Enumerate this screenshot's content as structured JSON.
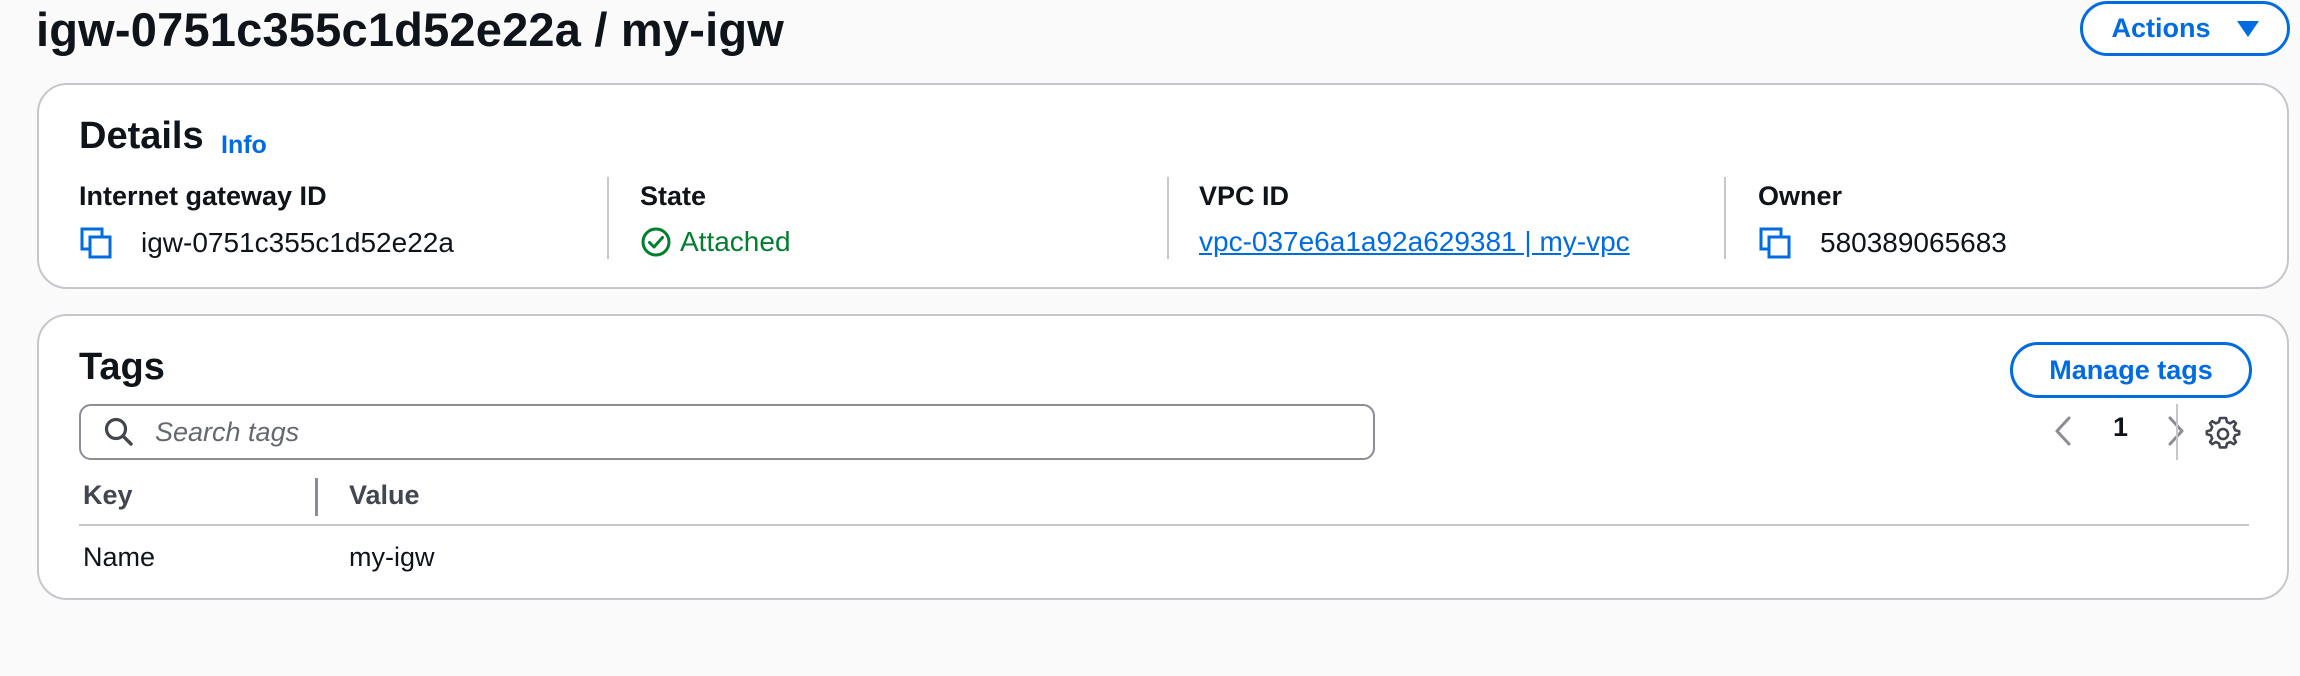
{
  "header": {
    "title": "igw-0751c355c1d52e22a / my-igw",
    "actions_label": "Actions"
  },
  "details": {
    "heading": "Details",
    "info_label": "Info",
    "fields": [
      {
        "label": "Internet gateway ID",
        "value": "igw-0751c355c1d52e22a"
      },
      {
        "label": "State",
        "value": "Attached"
      },
      {
        "label": "VPC ID",
        "value": "vpc-037e6a1a92a629381 | my-vpc"
      },
      {
        "label": "Owner",
        "value": "580389065683"
      }
    ]
  },
  "tags": {
    "heading": "Tags",
    "manage_label": "Manage tags",
    "search_placeholder": "Search tags",
    "page_number": "1",
    "columns": [
      "Key",
      "Value"
    ],
    "rows": [
      {
        "key": "Name",
        "value": "my-igw"
      }
    ]
  },
  "colors": {
    "accent": "#006ce0",
    "success": "#00802f",
    "border": "#c6c6cd"
  },
  "icons": [
    "copy-icon",
    "check-circle-icon",
    "search-icon",
    "chevron-left-icon",
    "chevron-right-icon",
    "gear-icon",
    "caret-down-icon"
  ]
}
